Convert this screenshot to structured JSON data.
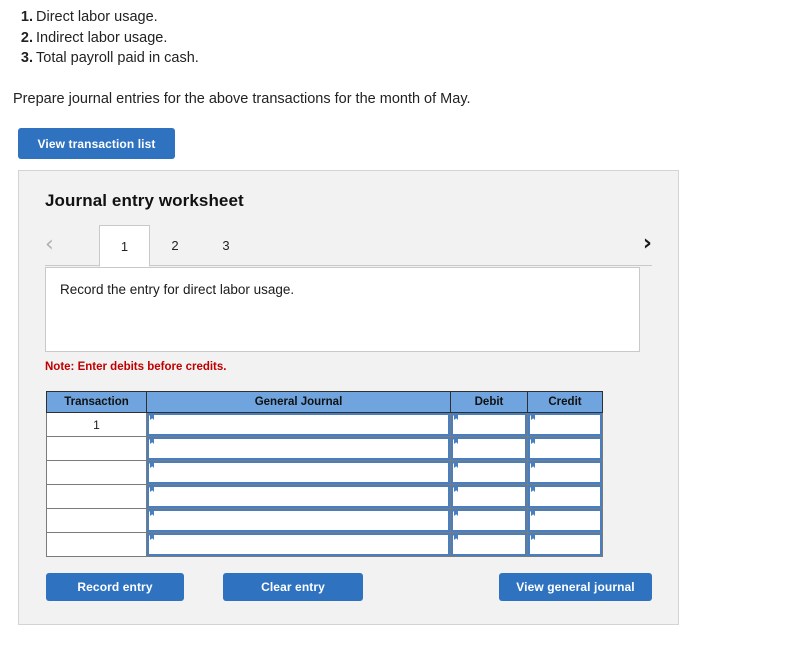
{
  "intro": {
    "requirements": [
      {
        "num": "1.",
        "text": "Direct labor usage."
      },
      {
        "num": "2.",
        "text": "Indirect labor usage."
      },
      {
        "num": "3.",
        "text": "Total payroll paid in cash."
      }
    ],
    "prompt": "Prepare journal entries for the above transactions for the month of May."
  },
  "buttons": {
    "view_transaction_list": "View transaction list",
    "record_entry": "Record entry",
    "clear_entry": "Clear entry",
    "view_general_journal": "View general journal"
  },
  "worksheet": {
    "title": "Journal entry worksheet",
    "nav": {
      "prev_icon": "chevron-left-icon",
      "next_icon": "chevron-right-icon",
      "prev_glyph": "‹",
      "next_glyph": "›"
    },
    "tabs": [
      {
        "label": "1",
        "active": true
      },
      {
        "label": "2",
        "active": false
      },
      {
        "label": "3",
        "active": false
      }
    ],
    "description": "Record the entry for direct labor usage.",
    "note": "Note: Enter debits before credits.",
    "table": {
      "headers": [
        "Transaction",
        "General Journal",
        "Debit",
        "Credit"
      ],
      "rows": [
        {
          "transaction": "1",
          "general_journal": "",
          "debit": "",
          "credit": ""
        },
        {
          "transaction": "",
          "general_journal": "",
          "debit": "",
          "credit": ""
        },
        {
          "transaction": "",
          "general_journal": "",
          "debit": "",
          "credit": ""
        },
        {
          "transaction": "",
          "general_journal": "",
          "debit": "",
          "credit": ""
        },
        {
          "transaction": "",
          "general_journal": "",
          "debit": "",
          "credit": ""
        },
        {
          "transaction": "",
          "general_journal": "",
          "debit": "",
          "credit": ""
        }
      ]
    }
  },
  "colors": {
    "accent_button": "#2e72c0",
    "table_header": "#6fa4de",
    "note_red": "#c00000",
    "panel_bg": "#f2f2f2",
    "cell_border_blue": "#4a7fbf"
  }
}
